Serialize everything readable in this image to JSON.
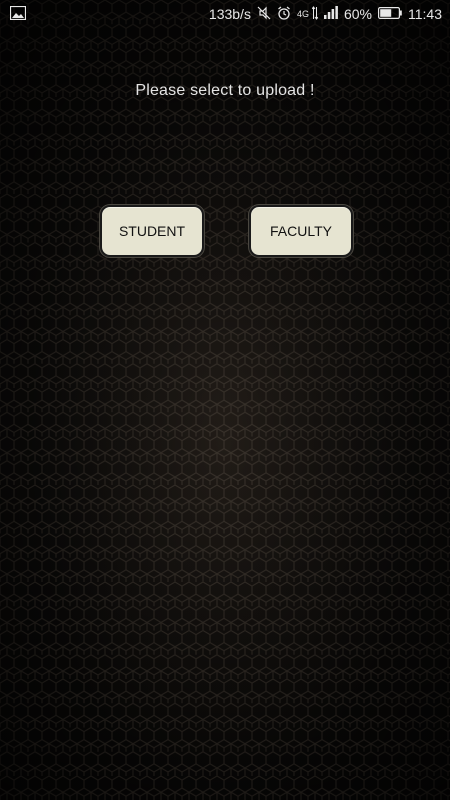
{
  "status_bar": {
    "network_speed": "133b/s",
    "network_type": "4G",
    "battery_percent": "60%",
    "time": "11:43",
    "icons": [
      "image-icon",
      "mute-icon",
      "alarm-icon",
      "data-arrows-icon",
      "signal-icon",
      "battery-icon"
    ]
  },
  "main": {
    "prompt": "Please select to upload !",
    "buttons": {
      "student": "STUDENT",
      "faculty": "FACULTY"
    }
  },
  "colors": {
    "background": "#141210",
    "button_fill": "#e6e4d1",
    "button_text": "#111111",
    "prompt_text": "#e4e4e4"
  }
}
